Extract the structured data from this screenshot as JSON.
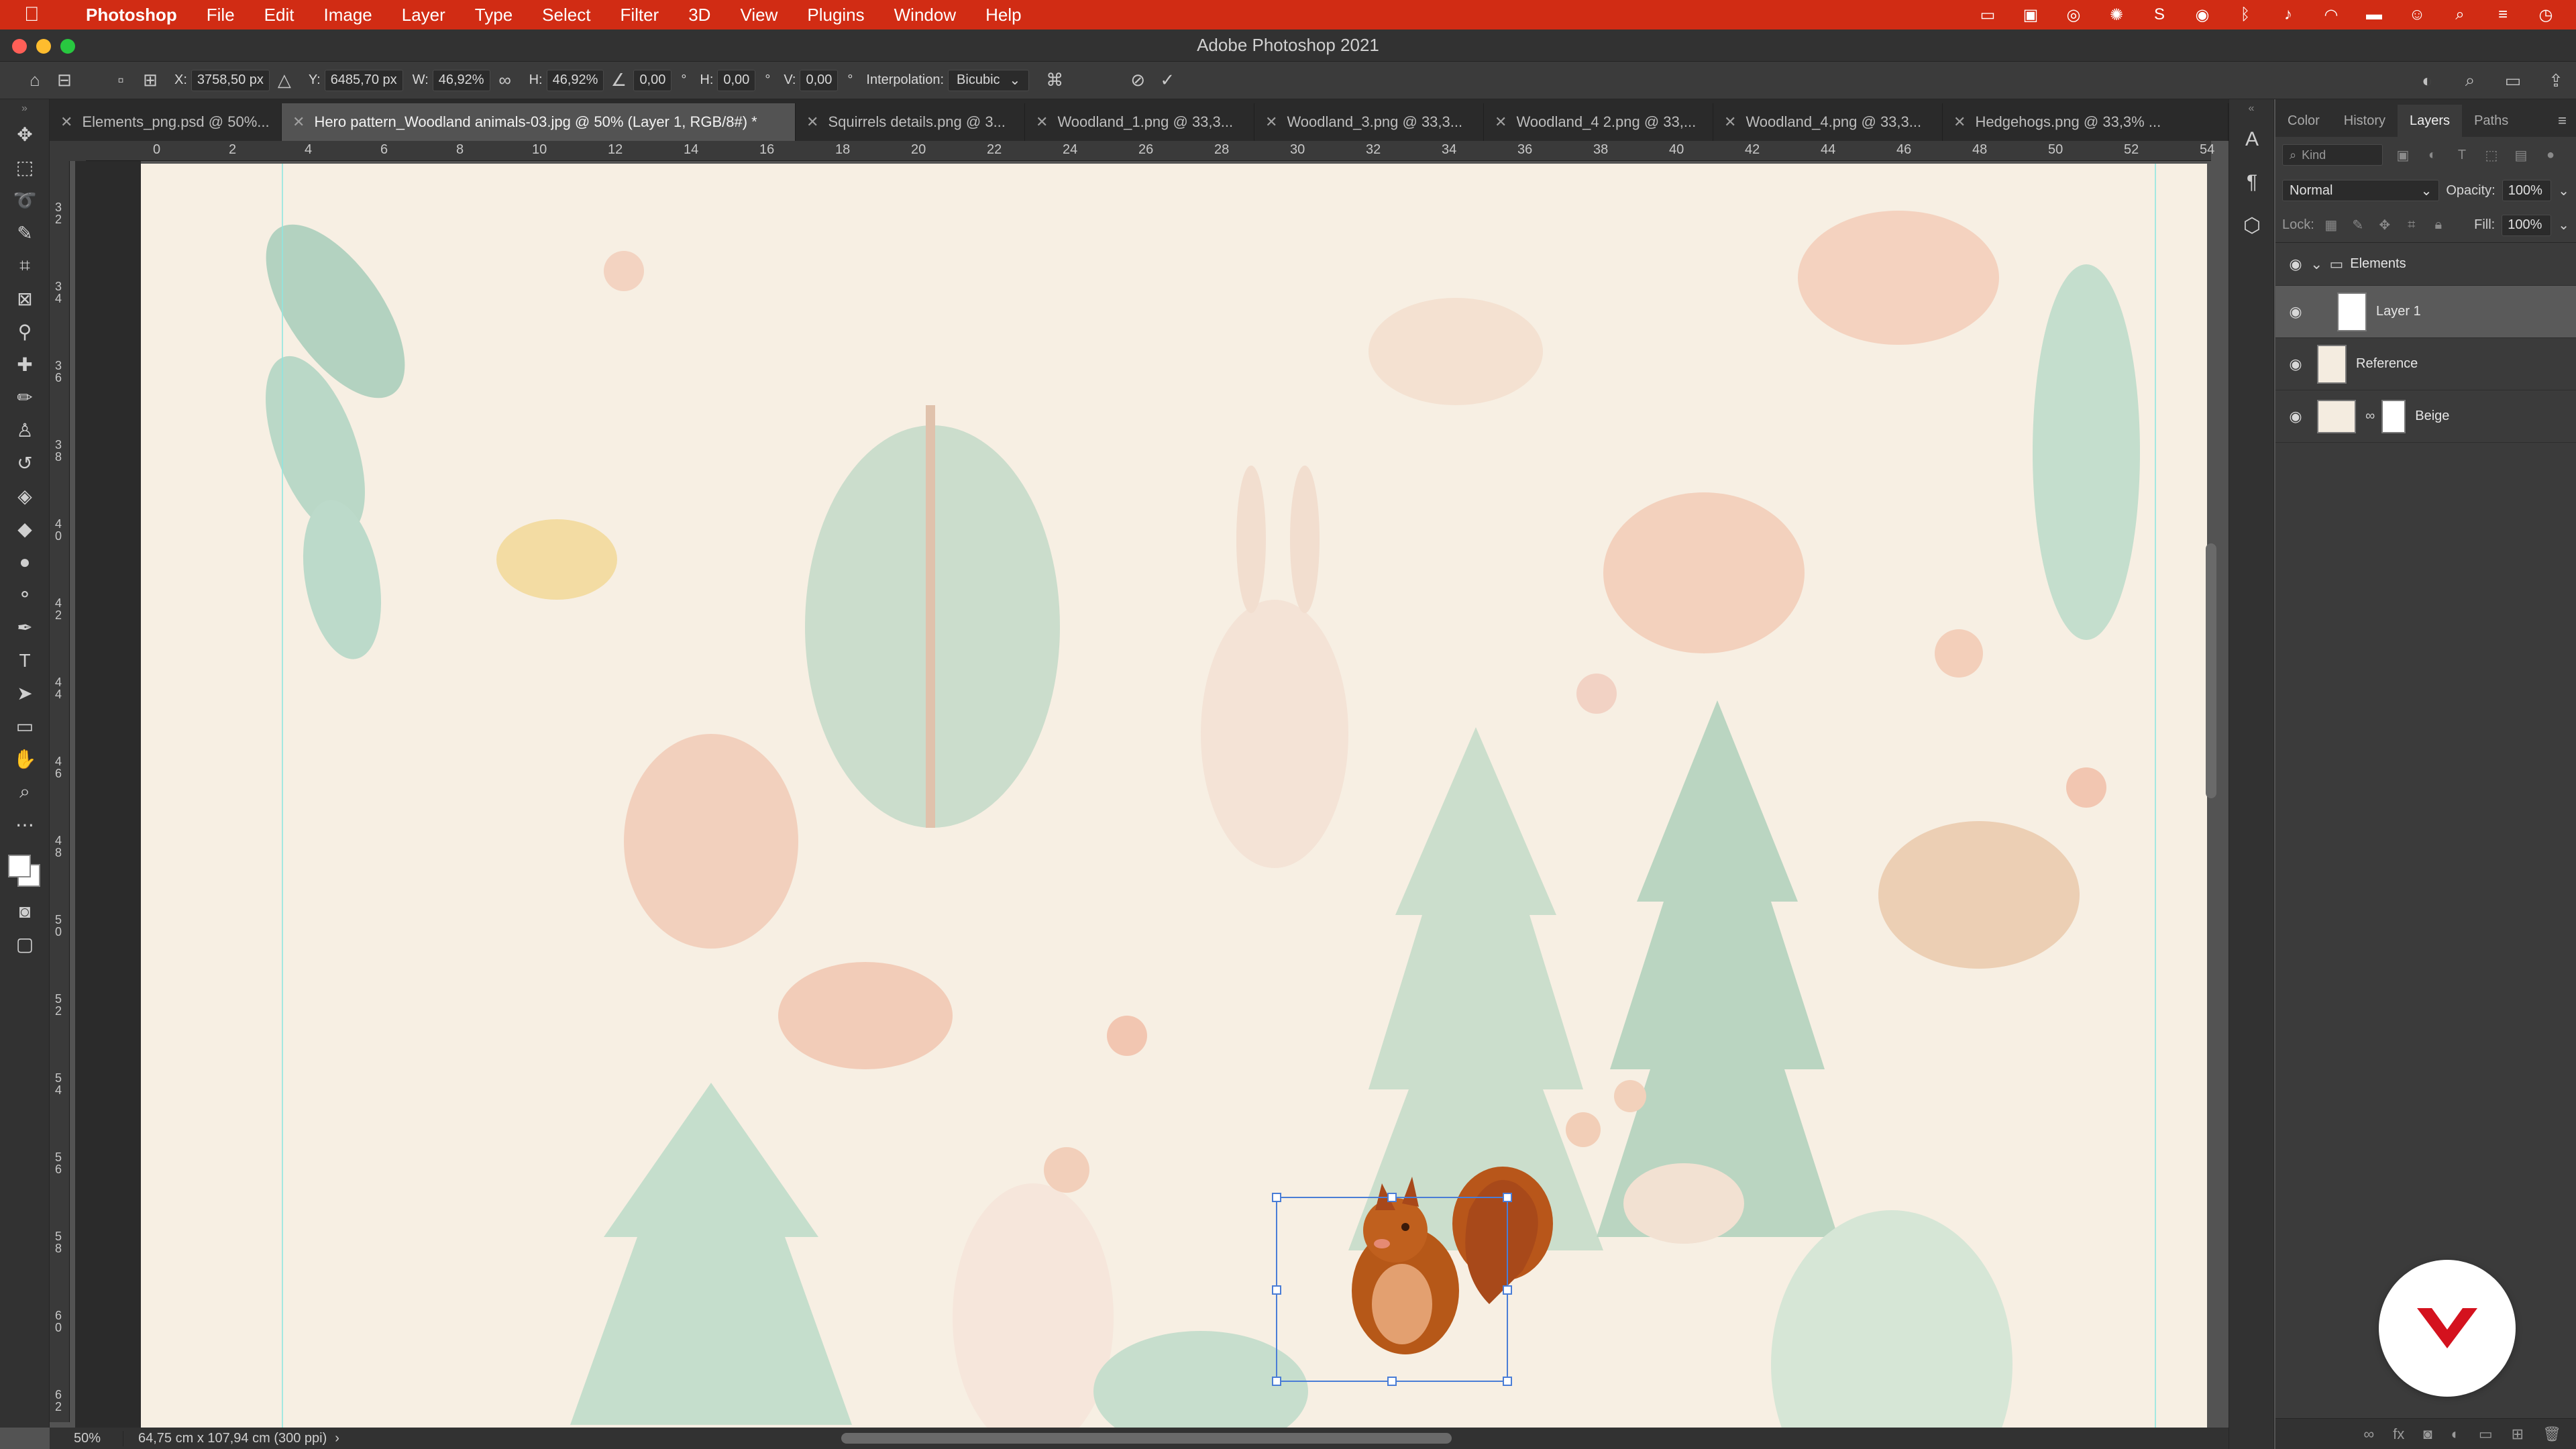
{
  "menubar": {
    "app_name": "Photoshop",
    "items": [
      "File",
      "Edit",
      "Image",
      "Layer",
      "Type",
      "Select",
      "Filter",
      "3D",
      "View",
      "Plugins",
      "Window",
      "Help"
    ]
  },
  "window": {
    "title": "Adobe Photoshop 2021"
  },
  "options": {
    "x_label": "X:",
    "x_value": "3758,50 px",
    "y_label": "Y:",
    "y_value": "6485,70 px",
    "w_label": "W:",
    "w_value": "46,92%",
    "h_label": "H:",
    "h_value": "46,92%",
    "angle_value": "0,00",
    "angle_unit": "°",
    "hskew_label": "H:",
    "hskew_value": "0,00",
    "vskew_label": "V:",
    "vskew_value": "0,00",
    "skew_unit": "°",
    "interpolation_label": "Interpolation:",
    "interpolation_value": "Bicubic"
  },
  "tabs": [
    {
      "label": "Elements_png.psd @ 50%..."
    },
    {
      "label": "Hero pattern_Woodland animals-03.jpg @ 50% (Layer 1, RGB/8#) *"
    },
    {
      "label": "Squirrels details.png @ 3..."
    },
    {
      "label": "Woodland_1.png @ 33,3..."
    },
    {
      "label": "Woodland_3.png @ 33,3..."
    },
    {
      "label": "Woodland_4 2.png @ 33,..."
    },
    {
      "label": "Woodland_4.png @ 33,3..."
    },
    {
      "label": "Hedgehogs.png @ 33,3% ..."
    }
  ],
  "ruler_top": [
    "0",
    "2",
    "4",
    "6",
    "8",
    "10",
    "12",
    "14",
    "16",
    "18",
    "20",
    "22",
    "24",
    "26",
    "28",
    "30",
    "32",
    "34",
    "36",
    "38",
    "40",
    "42",
    "44",
    "46",
    "48",
    "50",
    "52",
    "54"
  ],
  "ruler_left": [
    "3",
    "2",
    "3",
    "4",
    "3",
    "6",
    "3",
    "8",
    "4",
    "0",
    "4",
    "2",
    "4",
    "4",
    "4",
    "6",
    "4",
    "8",
    "5",
    "0",
    "5",
    "2",
    "5",
    "4",
    "5",
    "6",
    "5",
    "8",
    "6",
    "0",
    "6",
    "2"
  ],
  "status": {
    "zoom": "50%",
    "doc_info": "64,75 cm x 107,94 cm (300 ppi)"
  },
  "panel": {
    "tabs": [
      "Color",
      "History",
      "Layers",
      "Paths"
    ],
    "active_tab": "Layers",
    "filter_placeholder": "Kind",
    "blend_mode": "Normal",
    "opacity_label": "Opacity:",
    "opacity_value": "100%",
    "lock_label": "Lock:",
    "fill_label": "Fill:",
    "fill_value": "100%",
    "layers": [
      {
        "name": "Elements",
        "type": "group"
      },
      {
        "name": "Layer 1",
        "type": "pixel",
        "selected": true
      },
      {
        "name": "Reference",
        "type": "pixel"
      },
      {
        "name": "Beige",
        "type": "fill"
      }
    ]
  },
  "colors": {
    "menubar": "#d12c14",
    "canvas_bg": "#f7efe3",
    "squirrel": "#b4521a",
    "guide": "#8fe6e0",
    "transform": "#4a7dd6",
    "brand_mark": "#d4121e"
  },
  "icons": {
    "tools": [
      "move-icon",
      "marquee-icon",
      "lasso-icon",
      "magic-wand-icon",
      "crop-icon",
      "frame-icon",
      "eyedropper-icon",
      "healing-brush-icon",
      "brush-icon",
      "clone-stamp-icon",
      "history-brush-icon",
      "eraser-icon",
      "paint-bucket-icon",
      "blur-icon",
      "dodge-icon",
      "pen-icon",
      "type-icon",
      "path-selection-icon",
      "rectangle-icon",
      "hand-icon",
      "zoom-icon",
      "more-tools-icon"
    ]
  }
}
